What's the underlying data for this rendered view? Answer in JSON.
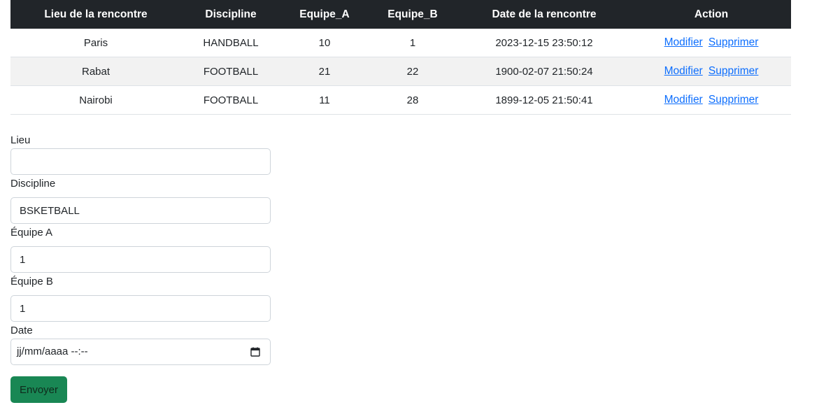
{
  "table": {
    "headers": [
      "Lieu de la rencontre",
      "Discipline",
      "Equipe_A",
      "Equipe_B",
      "Date de la rencontre",
      "Action"
    ],
    "rows": [
      {
        "lieu": "Paris",
        "discipline": "HANDBALL",
        "equipe_a": "10",
        "equipe_b": "1",
        "date": "2023-12-15 23:50:12"
      },
      {
        "lieu": "Rabat",
        "discipline": "FOOTBALL",
        "equipe_a": "21",
        "equipe_b": "22",
        "date": "1900-02-07 21:50:24"
      },
      {
        "lieu": "Nairobi",
        "discipline": "FOOTBALL",
        "equipe_a": "11",
        "equipe_b": "28",
        "date": "1899-12-05 21:50:41"
      }
    ],
    "edit_label": "Modifier",
    "delete_label": "Supprimer"
  },
  "form": {
    "lieu_label": "Lieu",
    "lieu_value": "",
    "discipline_label": "Discipline",
    "discipline_value": "BSKETBALL",
    "equipe_a_label": "Équipe A",
    "equipe_a_value": "1",
    "equipe_b_label": "Équipe B",
    "equipe_b_value": "1",
    "date_label": "Date",
    "date_placeholder": "jj/mm/aaaa --:--",
    "submit_label": "Envoyer"
  },
  "colors": {
    "header_bg": "#212529",
    "link": "#0d6efd",
    "button": "#198754",
    "stripe": "#f2f2f2"
  },
  "icons": {
    "date_picker": "calendar-icon"
  }
}
